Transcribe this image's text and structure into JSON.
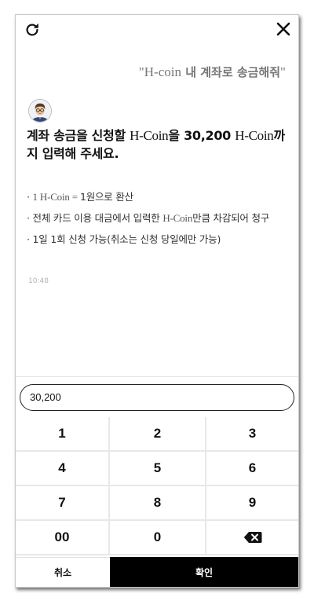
{
  "header": {
    "refresh_icon": "refresh-icon",
    "close_icon": "close-icon"
  },
  "user_message": {
    "open_quote": "\"",
    "brand": "H-coin",
    "text": " 내 계좌로 송금해줘",
    "close_quote": "\""
  },
  "bot_message": {
    "avatar_icon": "avatar-icon",
    "title_part1": "계좌 송금을 신청할 ",
    "title_brand1": "H-Coin",
    "title_part2": "을 30,200 ",
    "title_brand2": "H-Coin",
    "title_part3": "까지 입력해 주세요.",
    "items": [
      {
        "prefix": "· ",
        "brand": "1 H-Coin = ",
        "text": "1원으로 환산"
      },
      {
        "prefix": "· ",
        "text_pre": "전체 카드 이용 대금에서 입력한 ",
        "brand": "H-Coin",
        "text": "만큼 차감되어 청구"
      },
      {
        "prefix": "· ",
        "text": "1일 1회 신청 가능(취소는 신청 당일에만 가능)"
      }
    ],
    "timestamp": "10:48"
  },
  "input": {
    "value": "30,200"
  },
  "keypad": {
    "keys": [
      "1",
      "2",
      "3",
      "4",
      "5",
      "6",
      "7",
      "8",
      "9",
      "00",
      "0"
    ],
    "backspace_icon": "backspace-icon"
  },
  "actions": {
    "cancel_label": "취소",
    "confirm_label": "확인"
  },
  "colors": {
    "confirm_bg": "#000000",
    "timestamp": "#b5b5b5",
    "user_message": "#777777"
  }
}
